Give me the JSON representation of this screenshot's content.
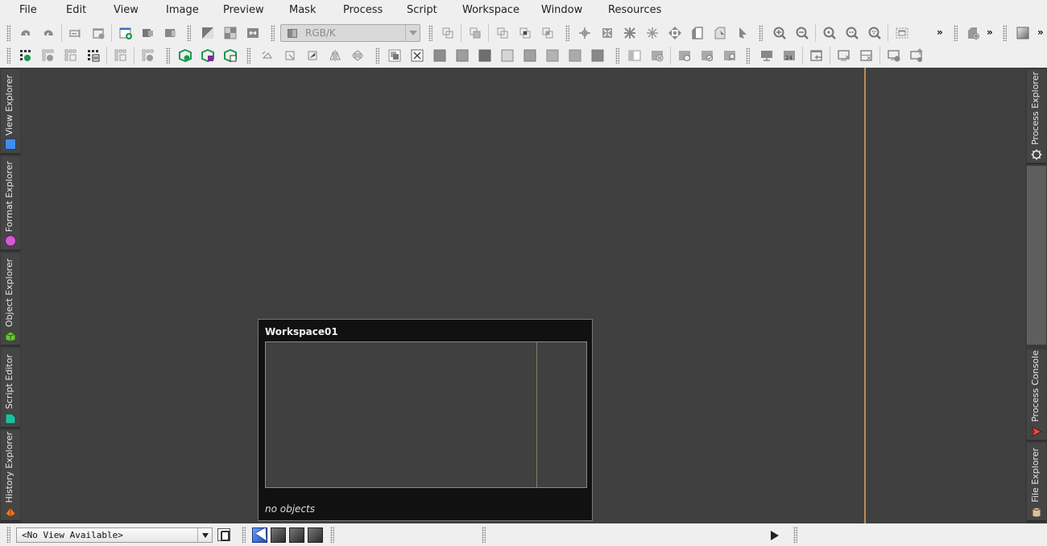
{
  "menubar": {
    "items": [
      "File",
      "Edit",
      "View",
      "Image",
      "Preview",
      "Mask",
      "Process",
      "Script",
      "Workspace",
      "Window",
      "Resources"
    ]
  },
  "toolbar1": {
    "buttons": [
      "undo-icon",
      "redo-icon",
      "rename-icon",
      "new-window-icon",
      "new-image-icon",
      "duplicate-icon",
      "extract-icon",
      "invert-icon",
      "crop-icon",
      "resample-icon",
      "preview-new-icon",
      "preview-copy-icon",
      "preview-union-icon",
      "preview-intersect-icon",
      "preview-subtract-icon",
      "pan-icon",
      "fit-icon",
      "shrink-icon",
      "expand-icon",
      "move-icon",
      "page-icon",
      "select-page-icon",
      "pointer-icon",
      "zoom-in-icon",
      "zoom-out-icon",
      "zoom-1-icon",
      "zoom-2-icon",
      "zoom-3-icon",
      "fit-view-icon",
      "new-workspace-icon",
      "gradient-swatch-icon"
    ],
    "color_space": "RGB/K",
    "more": "»"
  },
  "toolbar2": {
    "buttons": [
      "open-project-icon",
      "new-project-icon",
      "save-project-icon",
      "project-props-icon",
      "save-all-icon",
      "close-project-icon",
      "load-process-icon",
      "save-process-icon",
      "process-props-icon",
      "rotate-icon",
      "crop-corner-icon",
      "resize-icon",
      "mirror-h-icon",
      "mirror-v-icon",
      "overlay-icon",
      "close-x-icon",
      "swatch-1",
      "swatch-2",
      "swatch-3",
      "swatch-4",
      "swatch-5",
      "swatch-6",
      "swatch-7",
      "swatch-8",
      "mask-view-icon",
      "mask-remove-icon",
      "mask-edit-icon",
      "mask-check-icon",
      "mask-search-icon",
      "monitor-icon",
      "monitor-24-icon",
      "import-icon",
      "screen-close-icon",
      "screen-close-2-icon",
      "screen-radiation-icon",
      "screen-upload-icon"
    ]
  },
  "dock_left": [
    {
      "label": "View Explorer",
      "icon": "view-explorer-icon",
      "color": "#3d8ef0"
    },
    {
      "label": "Format Explorer",
      "icon": "format-explorer-icon",
      "color": "#d35ad6"
    },
    {
      "label": "Object Explorer",
      "icon": "object-explorer-icon",
      "color": "#6cc43a"
    },
    {
      "label": "Script Editor",
      "icon": "script-editor-icon",
      "color": "#1fbf9f"
    },
    {
      "label": "History Explorer",
      "icon": "history-explorer-icon",
      "color": "#f07a2e"
    }
  ],
  "dock_right": [
    {
      "label": "Process Explorer",
      "icon": "gear-icon"
    },
    {
      "label": "Process Console",
      "icon": "process-console-icon",
      "color": "#e2503a"
    },
    {
      "label": "File Explorer",
      "icon": "file-explorer-icon",
      "color": "#d9c39e"
    }
  ],
  "workspace_popup": {
    "title": "Workspace01",
    "status": "no objects"
  },
  "bottombar": {
    "view_select": "<No View Available>",
    "workspace_buttons": 4,
    "active_workspace": 1
  }
}
